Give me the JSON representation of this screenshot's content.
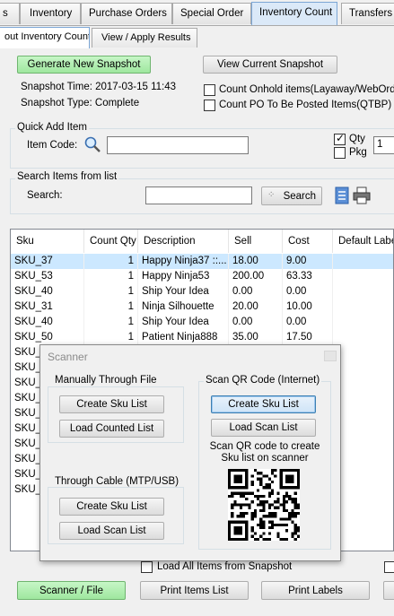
{
  "tabs": [
    {
      "label": "s"
    },
    {
      "label": "Inventory"
    },
    {
      "label": "Purchase Orders"
    },
    {
      "label": "Special Order"
    },
    {
      "label": "Inventory Count"
    },
    {
      "label": "Transfers"
    }
  ],
  "subtabs": [
    {
      "label": "out Inventory Count"
    },
    {
      "label": "View / Apply Results"
    }
  ],
  "snapshot": {
    "generate_label": "Generate New Snapshot",
    "view_label": "View Current Snapshot",
    "time": "Snapshot Time: 2017-03-15 11:43",
    "type": "Snapshot Type: Complete",
    "count_onhold": "Count Onhold items(Layaway/WebOrder)",
    "count_po": "Count PO To Be Posted Items(QTBP)"
  },
  "quick_add": {
    "title": "Quick Add Item",
    "item_code_label": "Item Code:",
    "item_code_value": "",
    "qty_label": "Qty",
    "pkg_label": "Pkg",
    "qty_value": "1"
  },
  "search": {
    "title": "Search Items from list",
    "label": "Search:",
    "value": "",
    "button": "Search"
  },
  "table": {
    "columns": [
      "Sku",
      "Count Qty",
      "Description",
      "Sell",
      "Cost",
      "Default Label"
    ],
    "rows": [
      [
        "SKU_37",
        "1",
        "Happy Ninja37 ::...",
        "18.00",
        "9.00",
        ""
      ],
      [
        "SKU_53",
        "1",
        "Happy Ninja53",
        "200.00",
        "63.33",
        ""
      ],
      [
        "SKU_40",
        "1",
        "Ship Your Idea",
        "0.00",
        "0.00",
        ""
      ],
      [
        "SKU_31",
        "1",
        "Ninja Silhouette",
        "20.00",
        "10.00",
        ""
      ],
      [
        "SKU_40",
        "1",
        "Ship Your Idea",
        "0.00",
        "0.00",
        ""
      ],
      [
        "SKU_50",
        "1",
        "Patient Ninja888",
        "35.00",
        "17.50",
        ""
      ],
      [
        "SKU_",
        "",
        "",
        "",
        "",
        ""
      ],
      [
        "SKU_",
        "",
        "",
        "",
        "",
        ""
      ],
      [
        "SKU_",
        "",
        "",
        "",
        "",
        ""
      ],
      [
        "SKU_",
        "",
        "",
        "",
        "",
        ""
      ],
      [
        "SKU_",
        "",
        "",
        "",
        "",
        ""
      ],
      [
        "SKU_",
        "",
        "",
        "",
        "",
        ""
      ],
      [
        "SKU_",
        "",
        "",
        "",
        "",
        ""
      ],
      [
        "SKU_",
        "",
        "",
        "",
        "",
        ""
      ],
      [
        "SKU_",
        "",
        "",
        "",
        "",
        ""
      ],
      [
        "SKU_",
        "",
        "",
        "",
        "",
        ""
      ]
    ]
  },
  "scanner": {
    "title": "Scanner",
    "manual_group": "Manually Through File",
    "manual_create": "Create Sku List",
    "manual_load": "Load Counted List",
    "cable_group": "Through Cable (MTP/USB)",
    "cable_create": "Create Sku List",
    "cable_load": "Load Scan List",
    "qr_group": "Scan QR Code (Internet)",
    "qr_create": "Create Sku List",
    "qr_load": "Load Scan List",
    "qr_note_1": "Scan QR code to create",
    "qr_note_2": "Sku list on scanner"
  },
  "bottom": {
    "load_all_label": "Load All Items from Snapshot",
    "scanner_file": "Scanner / File",
    "print_items": "Print Items List",
    "print_labels": "Print Labels"
  }
}
